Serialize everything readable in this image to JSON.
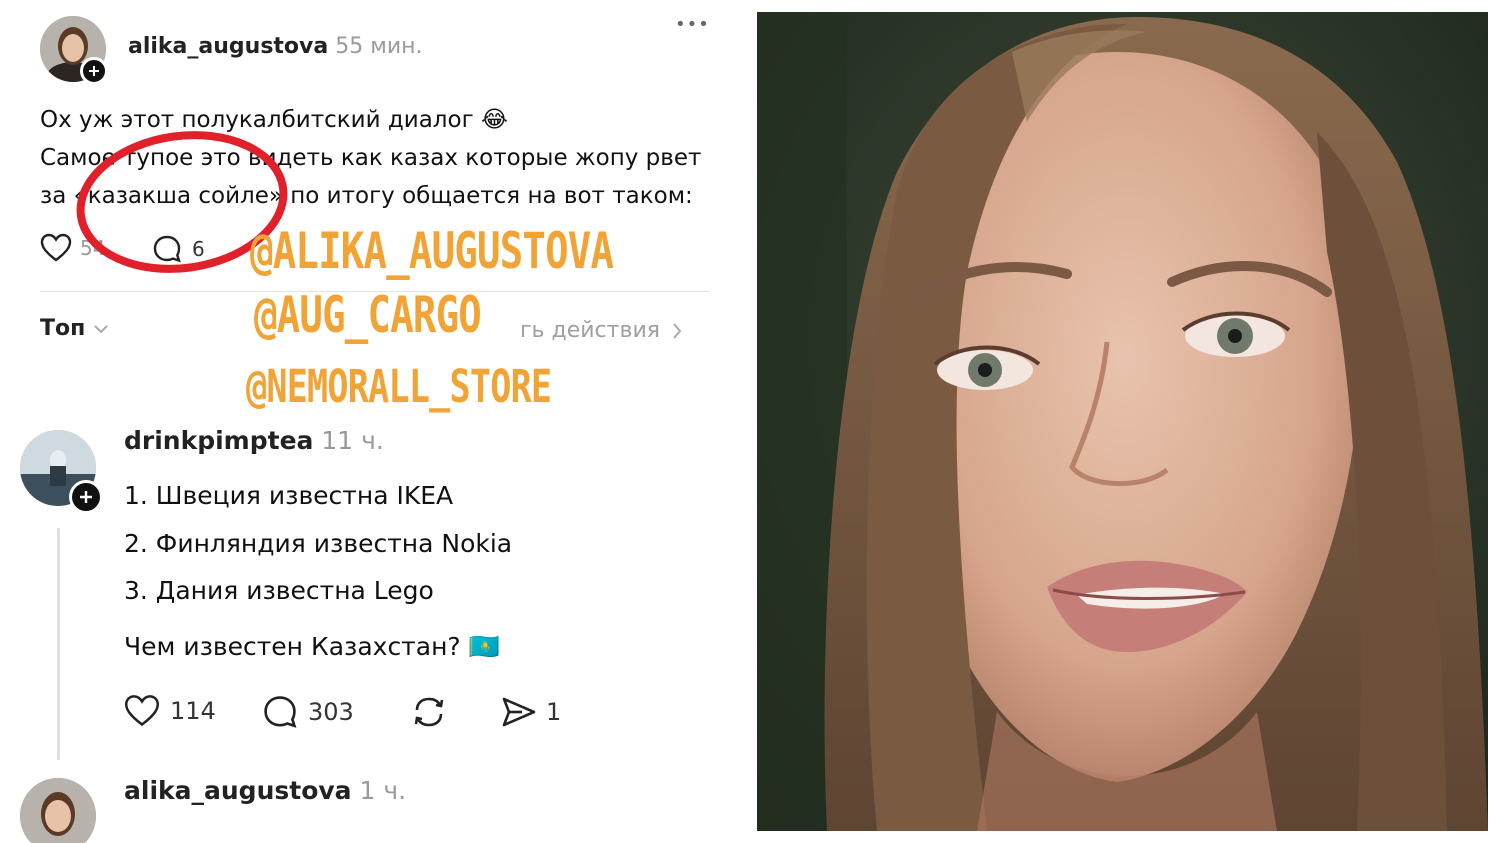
{
  "post": {
    "username": "alika_augustova",
    "time": "55 мин.",
    "more": "•••",
    "line1": "Ох уж этот полукалбитский диалог 😂",
    "line2": "Самое тупое это видеть как казах которые жопу рвет",
    "line3": "за «казакша сойле» по итогу общается на вот таком:",
    "likes": "54",
    "comments": "6"
  },
  "sort": {
    "label": "Топ",
    "activity_link": "гь действия"
  },
  "watermarks": [
    "@ALIKA_AUGUSTOVA",
    "@AUG_CARGO",
    "@NEMORALL_STORE"
  ],
  "reply": {
    "username": "drinkpimptea",
    "time": "11 ч.",
    "lines": [
      "1. Швеция известна IKEA",
      "2. Финляндия известна Nokia",
      "3. Дания известна Lego"
    ],
    "question": "Чем известен Казахстан? 🇰🇿",
    "likes": "114",
    "comments": "303",
    "shares": "1"
  },
  "reply2": {
    "username": "alika_augustova",
    "time": "1 ч."
  },
  "colors": {
    "watermark": "#f2a335",
    "highlight_circle": "#e0202a"
  },
  "icons": [
    "heart-icon",
    "comment-icon",
    "repost-icon",
    "share-icon",
    "more-icon",
    "plus-icon",
    "chevron-down-icon",
    "chevron-right-icon"
  ]
}
